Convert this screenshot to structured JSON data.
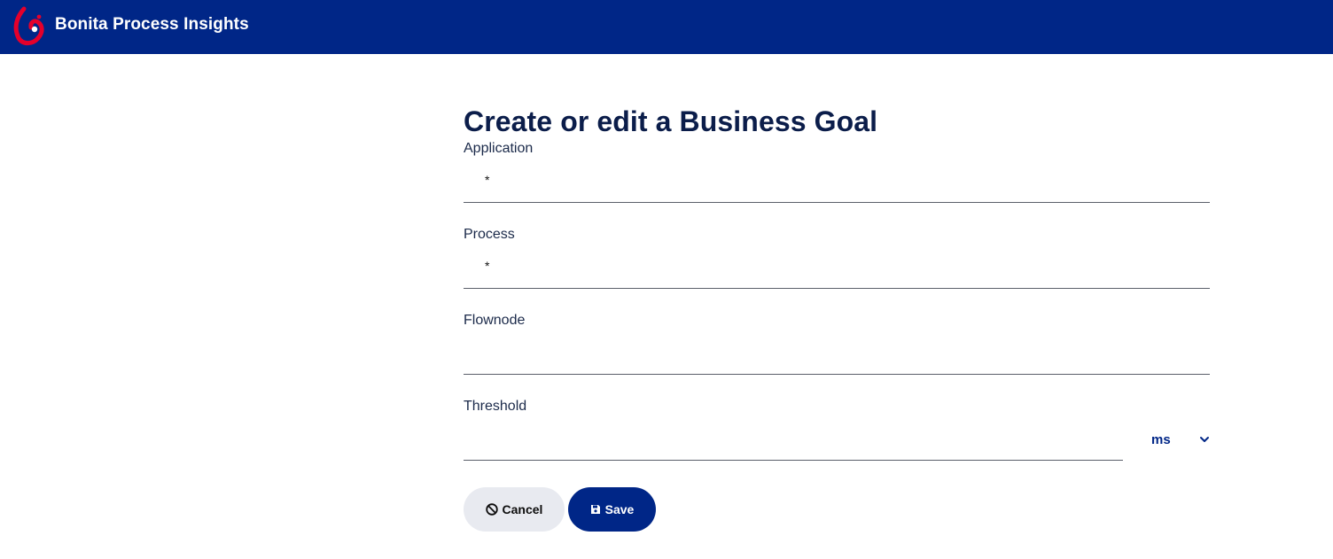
{
  "header": {
    "app_title": "Bonita Process Insights",
    "brand_color": "#002687",
    "logo_color": "#e4002b"
  },
  "page": {
    "title": "Create or edit a Business Goal"
  },
  "form": {
    "application": {
      "label": "Application",
      "required_mark": "*",
      "value": ""
    },
    "process": {
      "label": "Process",
      "required_mark": "*",
      "value": ""
    },
    "flownode": {
      "label": "Flownode",
      "value": ""
    },
    "threshold": {
      "label": "Threshold",
      "value": "",
      "unit": "ms"
    }
  },
  "actions": {
    "cancel_label": "Cancel",
    "cancel_icon": "prohibited-icon",
    "save_label": "Save",
    "save_icon": "floppy-disk-icon"
  }
}
